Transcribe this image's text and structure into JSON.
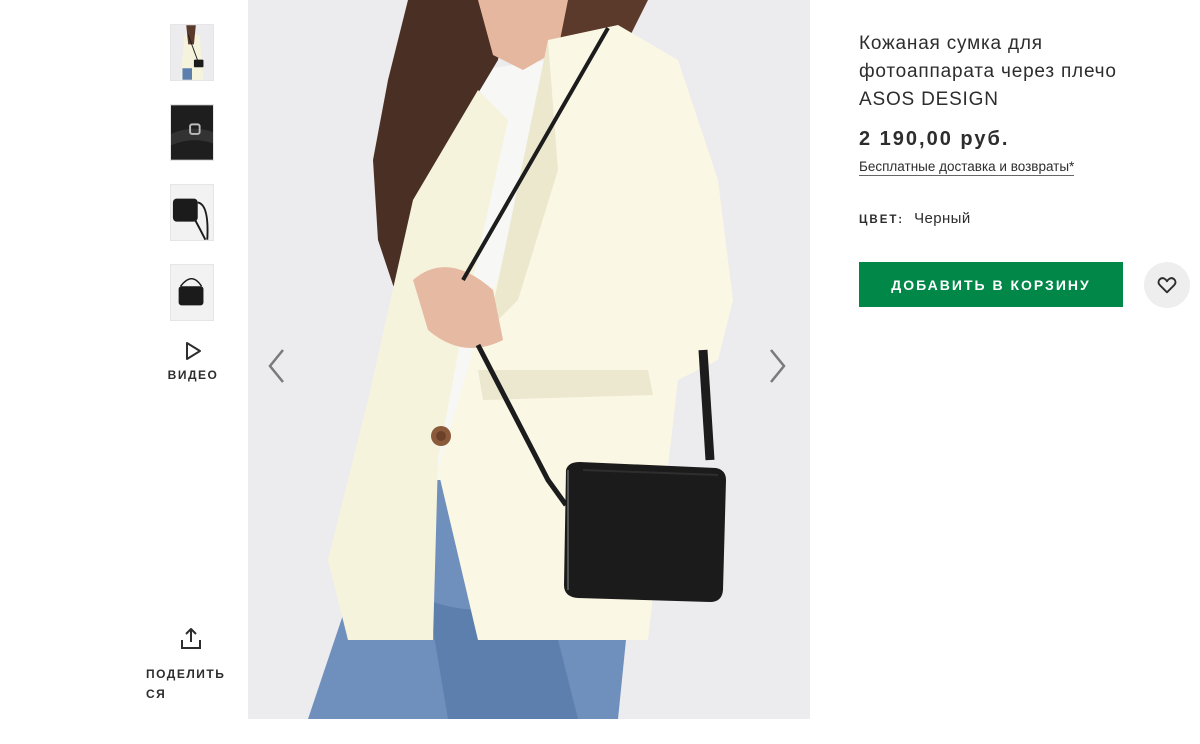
{
  "gallery": {
    "thumbnails": [
      {
        "alt": "model-wearing-bag-thumbnail"
      },
      {
        "alt": "bag-buckle-closeup-thumbnail"
      },
      {
        "alt": "bag-side-thumbnail"
      },
      {
        "alt": "bag-front-thumbnail"
      }
    ],
    "video_label": "ВИДЕО",
    "share_label": "ПОДЕЛИТЬСЯ",
    "prev_icon": "chevron-left-icon",
    "next_icon": "chevron-right-icon"
  },
  "product": {
    "title": "Кожаная сумка для фотоаппарата через плечо ASOS DESIGN",
    "price": "2 190,00 руб.",
    "delivery_link": "Бесплатные доставка и возвраты*",
    "color_label": "ЦВЕТ:",
    "color_value": "Черный",
    "add_to_cart_label": "ДОБАВИТЬ В КОРЗИНУ",
    "wishlist_icon": "heart-icon"
  },
  "colors": {
    "accent_green": "#018849",
    "text": "#2d2d2d",
    "wishlist_bg": "#eeeeee"
  }
}
